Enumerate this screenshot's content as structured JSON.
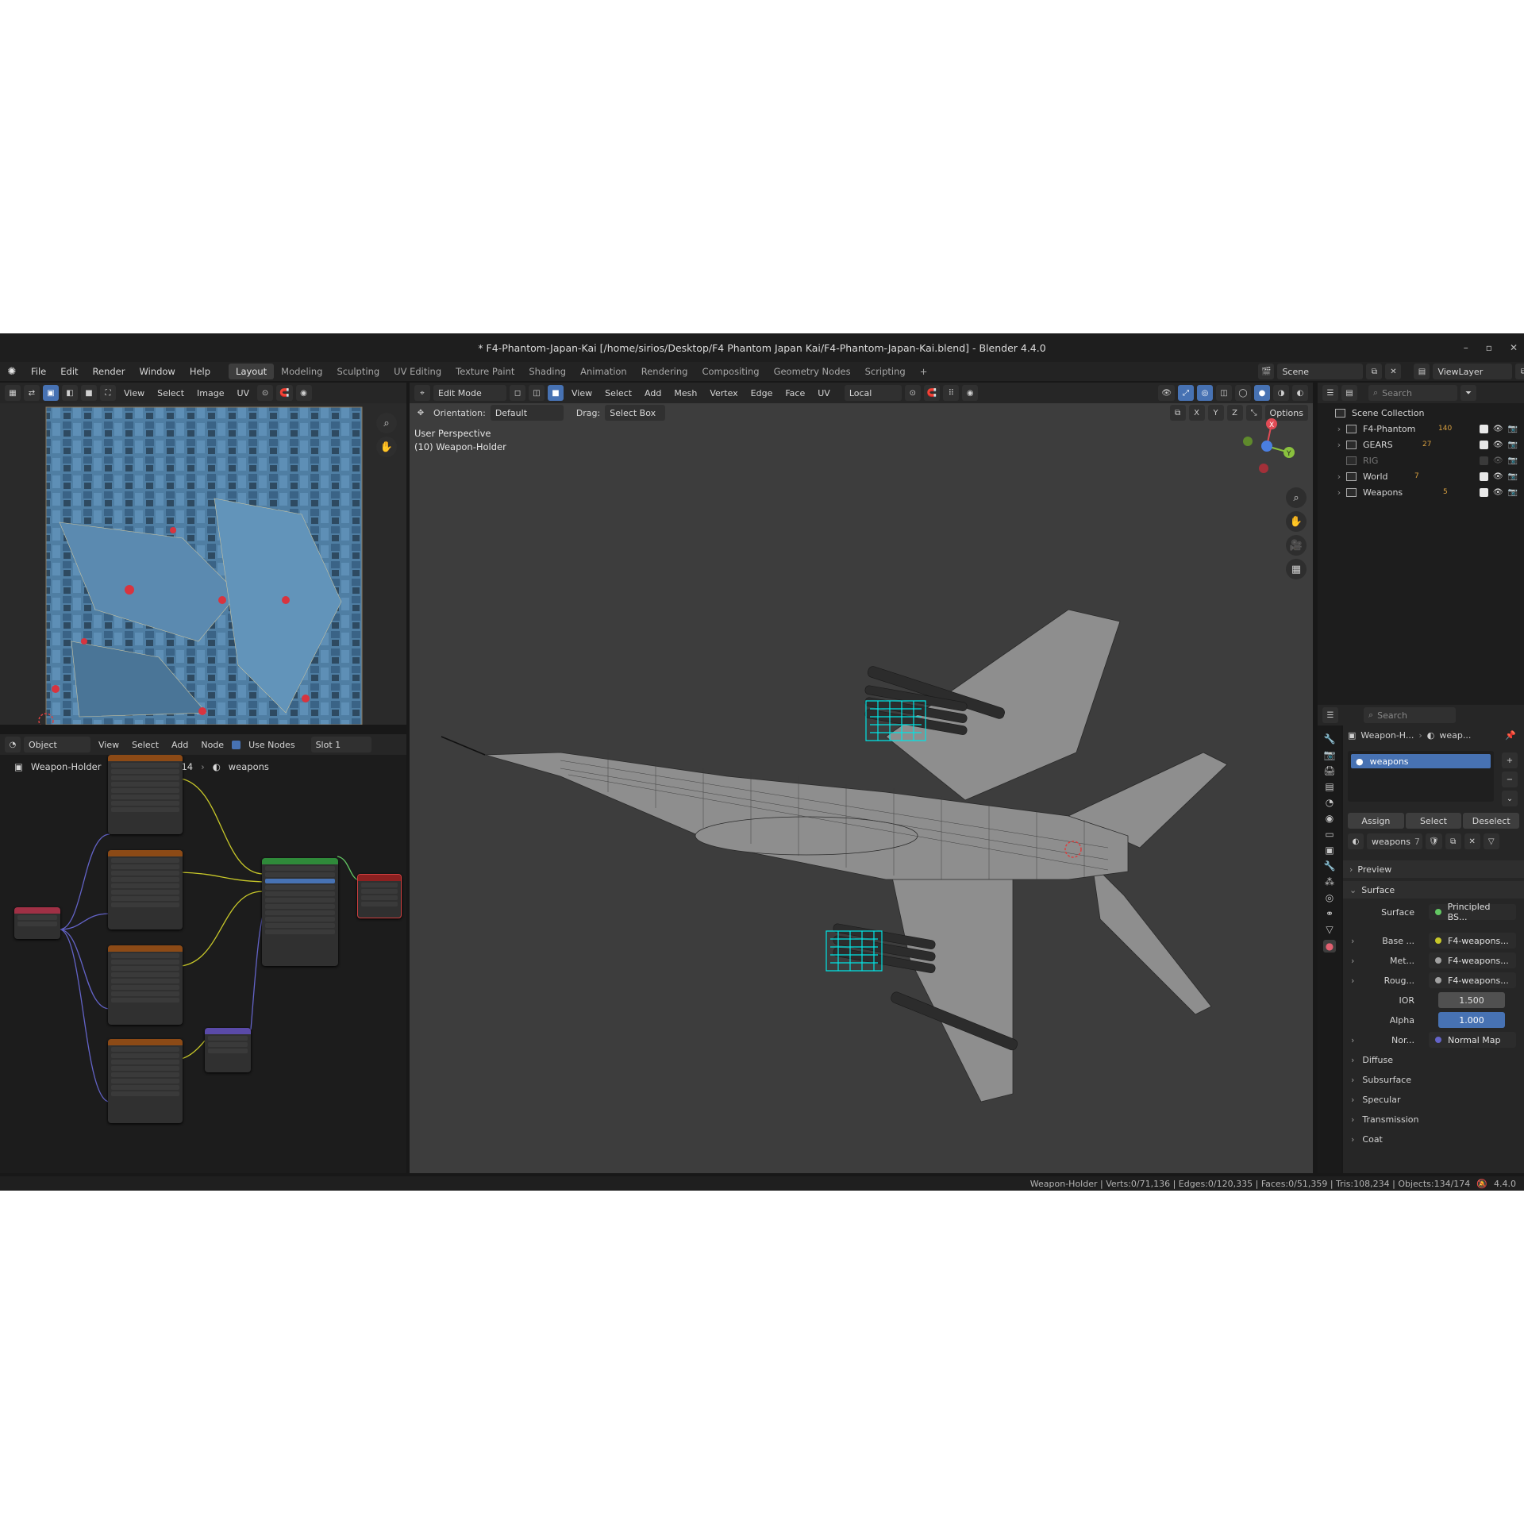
{
  "window": {
    "title": "* F4-Phantom-Japan-Kai [/home/sirios/Desktop/F4 Phantom Japan Kai/F4-Phantom-Japan-Kai.blend] - Blender 4.4.0",
    "controls": [
      "–",
      "▫",
      "✕"
    ]
  },
  "menu": {
    "items": [
      "File",
      "Edit",
      "Render",
      "Window",
      "Help"
    ],
    "workspaces": [
      "Layout",
      "Modeling",
      "Sculpting",
      "UV Editing",
      "Texture Paint",
      "Shading",
      "Animation",
      "Rendering",
      "Compositing",
      "Geometry Nodes",
      "Scripting"
    ],
    "active_workspace": "Layout",
    "add_tab": "+",
    "scene": "Scene",
    "view_layer": "ViewLayer"
  },
  "uv_editor": {
    "menus": [
      "View",
      "Select",
      "Image",
      "UV"
    ]
  },
  "node_editor": {
    "editor_type": "Object",
    "menus": [
      "View",
      "Select",
      "Add",
      "Node"
    ],
    "use_nodes_label": "Use Nodes",
    "slot": "Slot 1",
    "breadcrumb": [
      "Weapon-Holder",
      "Cylinder.014",
      "weapons"
    ]
  },
  "viewport": {
    "mode": "Edit Mode",
    "menus": [
      "View",
      "Select",
      "Add",
      "Mesh",
      "Vertex",
      "Edge",
      "Face",
      "UV"
    ],
    "pivot": "Local",
    "orientation_label": "Orientation:",
    "orientation_value": "Default",
    "drag_label": "Drag:",
    "drag_value": "Select Box",
    "options_label": "Options",
    "axes_labels": [
      "X",
      "Y",
      "Z"
    ],
    "overlay_line1": "User Perspective",
    "overlay_line2": "(10) Weapon-Holder",
    "gizmo": {
      "x": "X",
      "y": "Y"
    }
  },
  "outliner": {
    "search_placeholder": "Search",
    "root": "Scene Collection",
    "items": [
      {
        "label": "F4-Phantom",
        "badge": "140",
        "visible": true
      },
      {
        "label": "GEARS",
        "badge": "27",
        "visible": true
      },
      {
        "label": "RIG",
        "badge": "",
        "visible": false
      },
      {
        "label": "World",
        "badge": "7",
        "visible": true
      },
      {
        "label": "Weapons",
        "badge": "5",
        "visible": true
      }
    ]
  },
  "properties": {
    "search_placeholder": "Search",
    "breadcrumb": [
      "Weapon-H...",
      "weap..."
    ],
    "material_slot": "weapons",
    "buttons": [
      "Assign",
      "Select",
      "Deselect"
    ],
    "material_name": "weapons",
    "material_users": "7",
    "sections": {
      "preview": "Preview",
      "surface": "Surface"
    },
    "surface_label": "Surface",
    "surface_value": "Principled BS...",
    "rows": [
      {
        "label": "Base ...",
        "value": "F4-weapons...",
        "dot": "#c7c729"
      },
      {
        "label": "Met...",
        "value": "F4-weapons...",
        "dot": "#a1a1a1"
      },
      {
        "label": "Roug...",
        "value": "F4-weapons...",
        "dot": "#a1a1a1"
      }
    ],
    "ior_label": "IOR",
    "ior_value": "1.500",
    "alpha_label": "Alpha",
    "alpha_value": "1.000",
    "normal_label": "Nor...",
    "normal_value": "Normal Map",
    "subpanels": [
      "Diffuse",
      "Subsurface",
      "Specular",
      "Transmission",
      "Coat"
    ]
  },
  "status_bar": {
    "text": "Weapon-Holder | Verts:0/71,136 | Edges:0/120,335 | Faces:0/51,359 | Tris:108,234 | Objects:134/174",
    "version": "4.4.0"
  },
  "colors": {
    "accent": "#4772b3",
    "selection": "#00e5e5",
    "bg": "#181818",
    "viewport_bg": "#3d3d3d"
  }
}
